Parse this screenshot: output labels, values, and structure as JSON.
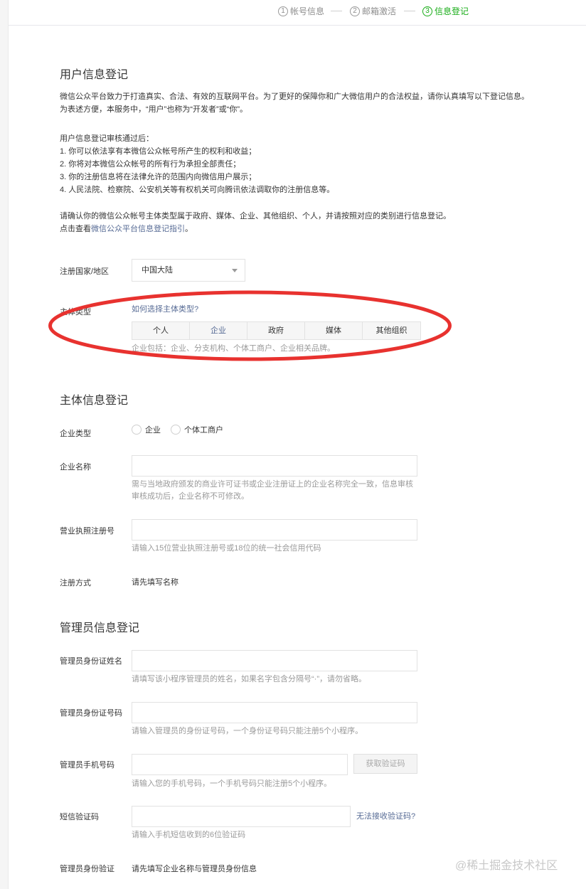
{
  "steps": [
    {
      "num": "1",
      "label": "帐号信息"
    },
    {
      "num": "2",
      "label": "邮箱激活"
    },
    {
      "num": "3",
      "label": "信息登记"
    }
  ],
  "user_info": {
    "title": "用户信息登记",
    "intro_1": "微信公众平台致力于打造真实、合法、有效的互联网平台。为了更好的保障你和广大微信用户的合法权益，请你认真填写以下登记信息。",
    "intro_2": "为表述方便，本服务中，“用户”也称为“开发者”或“你”。",
    "after_title": "用户信息登记审核通过后：",
    "items": [
      "1. 你可以依法享有本微信公众帐号所产生的权利和收益；",
      "2. 你将对本微信公众帐号的所有行为承担全部责任；",
      "3. 你的注册信息将在法律允许的范围内向微信用户展示；",
      "4. 人民法院、检察院、公安机关等有权机关可向腾讯依法调取你的注册信息等。"
    ],
    "confirm_text": "请确认你的微信公众帐号主体类型属于政府、媒体、企业、其他组织、个人，并请按照对应的类别进行信息登记。",
    "guide_prefix": "点击查看",
    "guide_link": "微信公众平台信息登记指引",
    "guide_suffix": "。"
  },
  "region": {
    "label": "注册国家/地区",
    "value": "中国大陆"
  },
  "subject_type": {
    "label": "主体类型",
    "help_link": "如何选择主体类型?",
    "options": [
      "个人",
      "企业",
      "政府",
      "媒体",
      "其他组织"
    ],
    "selected": "企业",
    "desc": "企业包括：企业、分支机构、个体工商户、企业相关品牌。"
  },
  "subject_info": {
    "title": "主体信息登记",
    "company_type_label": "企业类型",
    "company_type_options": [
      "企业",
      "个体工商户"
    ],
    "company_name_label": "企业名称",
    "company_name_hint_1": "需与当地政府颁发的商业许可证书或企业注册证上的企业名称完全一致，信息审核",
    "company_name_hint_2": "审核成功后，企业名称不可修改。",
    "license_label": "营业执照注册号",
    "license_hint": "请输入15位营业执照注册号或18位的统一社会信用代码",
    "reg_method_label": "注册方式",
    "reg_method_value": "请先填写名称"
  },
  "admin_info": {
    "title": "管理员信息登记",
    "name_label": "管理员身份证姓名",
    "name_hint": "请填写该小程序管理员的姓名，如果名字包含分隔号“·”，请勿省略。",
    "id_label": "管理员身份证号码",
    "id_hint": "请输入管理员的身份证号码，一个身份证号码只能注册5个小程序。",
    "phone_label": "管理员手机号码",
    "phone_hint": "请输入您的手机号码，一个手机号码只能注册5个小程序。",
    "get_code_button": "获取验证码",
    "sms_label": "短信验证码",
    "sms_hint": "请输入手机短信收到的6位验证码",
    "sms_help_link": "无法接收验证码?",
    "verify_label": "管理员身份验证",
    "verify_value": "请先填写企业名称与管理员身份信息"
  },
  "watermark": "@稀土掘金技术社区",
  "colors": {
    "accent_green": "#1aad19",
    "link_blue": "#576b95",
    "annotation_red": "#e8322f"
  }
}
